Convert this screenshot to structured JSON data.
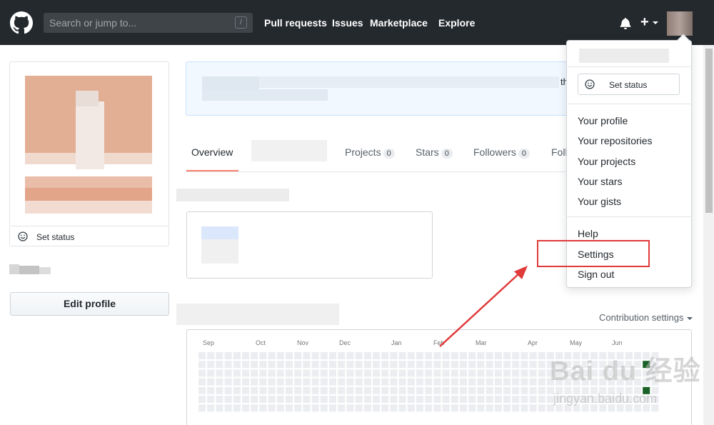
{
  "header": {
    "search_placeholder": "Search or jump to...",
    "search_shortcut": "/",
    "nav": [
      "Pull requests",
      "Issues",
      "Marketplace",
      "Explore"
    ],
    "plus_label": "+"
  },
  "profile": {
    "set_status_label": "Set status",
    "edit_profile_label": "Edit profile"
  },
  "tabs": [
    {
      "label": "Overview",
      "count": null
    },
    {
      "label": "Projects",
      "count": "0"
    },
    {
      "label": "Stars",
      "count": "0"
    },
    {
      "label": "Followers",
      "count": "0"
    },
    {
      "label": "Foll",
      "count": null
    }
  ],
  "flash_tail": "th",
  "contributions": {
    "settings_label": "Contribution settings",
    "months": [
      "Sep",
      "Oct",
      "Nov",
      "Dec",
      "Jan",
      "Feb",
      "Mar",
      "Apr",
      "May",
      "Jun"
    ]
  },
  "dropdown": {
    "set_status_label": "Set status",
    "items_group1": [
      "Your profile",
      "Your repositories",
      "Your projects",
      "Your stars",
      "Your gists"
    ],
    "items_group2": [
      "Help",
      "Settings",
      "Sign out"
    ]
  },
  "watermark": {
    "main": "Bai du 经验",
    "sub": "jingyan.baidu.com"
  },
  "colors": {
    "header_bg": "#24292e",
    "annotation_red": "#e03a3a",
    "active_tab_underline": "#f9826c"
  }
}
